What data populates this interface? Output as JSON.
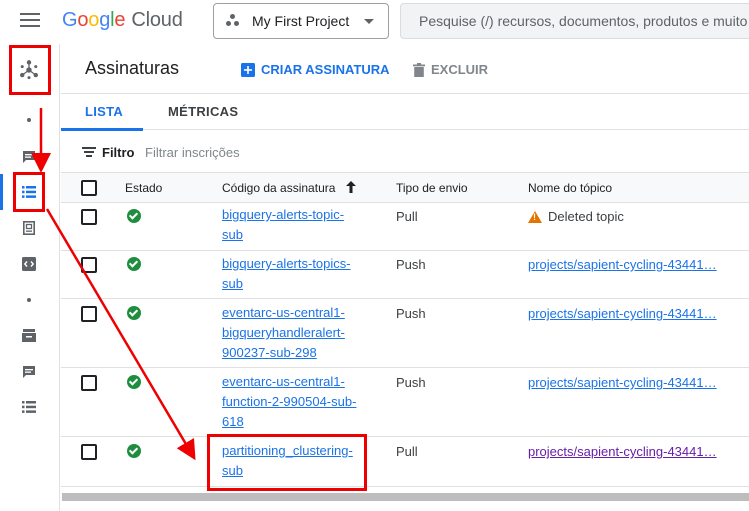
{
  "topbar": {
    "logo": [
      "G",
      "o",
      "o",
      "g",
      "l",
      "e"
    ],
    "logo_suffix": "Cloud",
    "project": "My First Project",
    "search_placeholder": "Pesquise (/) recursos, documentos, produtos e muito"
  },
  "header": {
    "title": "Assinaturas",
    "create_label": "CRIAR ASSINATURA",
    "delete_label": "EXCLUIR"
  },
  "tabs": [
    {
      "label": "LISTA",
      "active": true
    },
    {
      "label": "MÉTRICAS",
      "active": false
    }
  ],
  "filter": {
    "label": "Filtro",
    "placeholder": "Filtrar inscrições"
  },
  "table": {
    "headers": {
      "state": "Estado",
      "subscription": "Código da assinatura",
      "delivery": "Tipo de envio",
      "topic": "Nome do tópico"
    },
    "rows": [
      {
        "subscription": [
          "bigquery-alerts-topic-",
          "sub"
        ],
        "delivery": "Pull",
        "topic": "Deleted topic",
        "topic_deleted": true
      },
      {
        "subscription": [
          "bigquery-alerts-topics-",
          "sub"
        ],
        "delivery": "Push",
        "topic": "projects/sapient-cycling-43441…"
      },
      {
        "subscription": [
          "eventarc-us-central1-",
          "bigqueryhandleralert-",
          "900237-sub-298"
        ],
        "delivery": "Push",
        "topic": "projects/sapient-cycling-43441…"
      },
      {
        "subscription": [
          "eventarc-us-central1-",
          "function-2-990504-sub-",
          "618"
        ],
        "delivery": "Push",
        "topic": "projects/sapient-cycling-43441…"
      },
      {
        "subscription": [
          "partitioning_clustering-",
          "sub"
        ],
        "delivery": "Pull",
        "topic": "projects/sapient-cycling-43441…"
      }
    ]
  },
  "colors": {
    "accent": "#1a73e8",
    "success": "#1e8e3e",
    "warning": "#e37400",
    "annotation": "#ee0000"
  },
  "icons": [
    "menu-icon",
    "project-icon",
    "pubsub-icon",
    "topics-icon",
    "subscriptions-icon",
    "snapshots-icon",
    "schemas-icon",
    "lite-icon",
    "reservations-icon",
    "list-icon",
    "add-icon",
    "trash-icon",
    "filter-icon",
    "sort-up-icon",
    "check-circle-icon",
    "warning-icon"
  ]
}
